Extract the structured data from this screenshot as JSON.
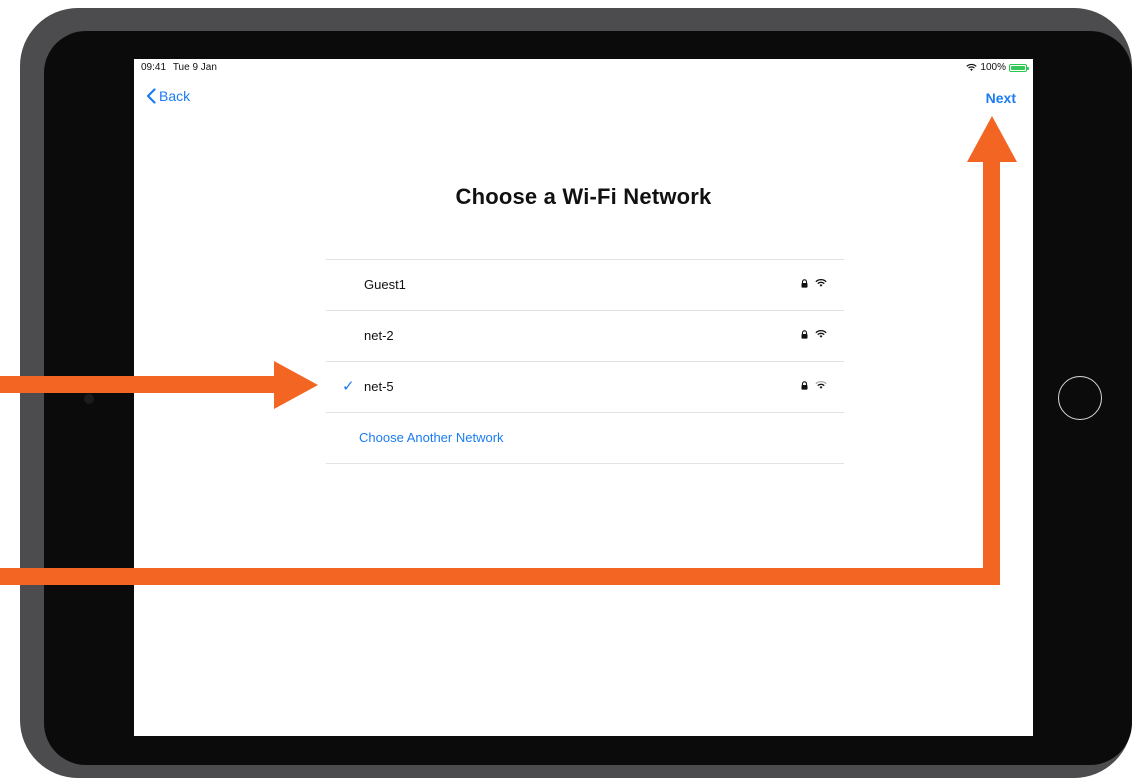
{
  "status_bar": {
    "time": "09:41",
    "date": "Tue 9 Jan",
    "battery_percent": "100%",
    "battery_level": 1.0
  },
  "nav": {
    "back_label": "Back",
    "next_label": "Next"
  },
  "title": "Choose a Wi-Fi Network",
  "networks": [
    {
      "name": "Guest1",
      "secured": true,
      "selected": false
    },
    {
      "name": "net-2",
      "secured": true,
      "selected": false
    },
    {
      "name": "net-5",
      "secured": true,
      "selected": true
    }
  ],
  "other_network_label": "Choose Another Network",
  "icons": {
    "lock": "lock-icon",
    "wifi": "wifi-icon",
    "check": "checkmark-icon",
    "back": "chevron-left-icon",
    "battery": "battery-icon"
  },
  "colors": {
    "accent": "#1b7cf2",
    "annotation": "#f26522",
    "battery": "#34c759",
    "device_frame": "#4c4c4e"
  },
  "check_glyph": "✓"
}
